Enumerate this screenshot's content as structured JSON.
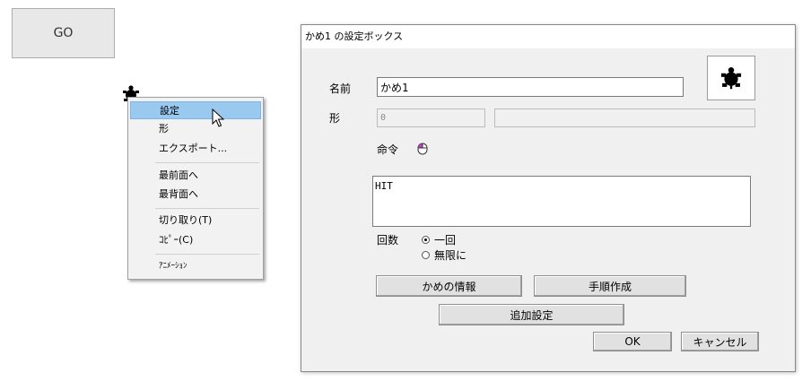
{
  "canvas": {
    "go_button_label": "GO"
  },
  "context_menu": {
    "items": [
      {
        "label": "設定",
        "selected": true
      },
      {
        "label": "形"
      },
      {
        "label": "エクスポート..."
      },
      {
        "label": "最前面へ"
      },
      {
        "label": "最背面へ"
      },
      {
        "label": "切り取り(T)"
      },
      {
        "label": "ｺﾋﾟｰ(C)"
      },
      {
        "label": "ｱﾆﾒｰｼｮﾝ"
      }
    ]
  },
  "dialog": {
    "title": "かめ1 の設定ボックス",
    "name_label": "名前",
    "name_value": "かめ1",
    "shape_label": "形",
    "shape_value": "0",
    "shape_extra_value": "",
    "command_label": "命令",
    "command_text": "HIT",
    "count_label": "回数",
    "count_options": [
      {
        "label": "一回",
        "checked": true
      },
      {
        "label": "無限に",
        "checked": false
      }
    ],
    "buttons": {
      "turtle_info": "かめの情報",
      "procedure": "手順作成",
      "additional_settings": "追加設定",
      "ok": "OK",
      "cancel": "キャンセル"
    }
  }
}
